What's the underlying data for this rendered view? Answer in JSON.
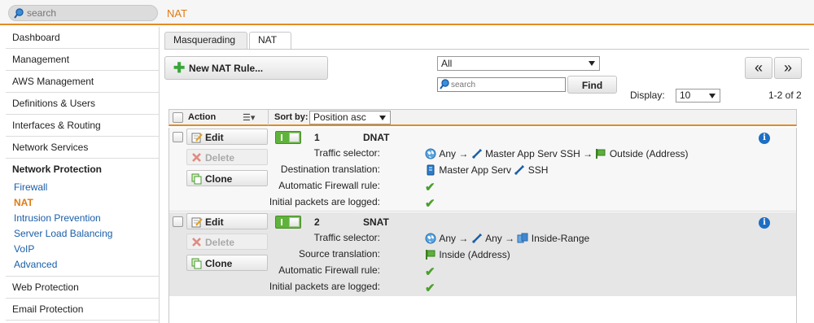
{
  "topbar": {
    "search_placeholder": "search",
    "page_title": "NAT"
  },
  "sidebar": {
    "items_top": [
      "Dashboard",
      "Management",
      "AWS Management",
      "Definitions & Users",
      "Interfaces & Routing",
      "Network Services"
    ],
    "group": {
      "title": "Network Protection",
      "subitems": [
        "Firewall",
        "NAT",
        "Intrusion Prevention",
        "Server Load Balancing",
        "VoIP",
        "Advanced"
      ],
      "active": "NAT"
    },
    "items_bottom": [
      "Web Protection",
      "Email Protection"
    ]
  },
  "tabs": [
    "Masquerading",
    "NAT"
  ],
  "active_tab": "NAT",
  "toolbar": {
    "new_rule_label": "New NAT Rule...",
    "filter_value": "All",
    "list_search_placeholder": "search",
    "find_label": "Find",
    "prev_label": "«",
    "next_label": "»",
    "display_label": "Display:",
    "display_value": "10",
    "count_text": "1-2 of 2"
  },
  "list_header": {
    "action_label": "Action",
    "sort_by_label": "Sort by:",
    "sort_value": "Position asc"
  },
  "rule_buttons": {
    "edit": "Edit",
    "delete": "Delete",
    "clone": "Clone"
  },
  "rules": [
    {
      "number": "1",
      "type": "DNAT",
      "enabled": true,
      "props": {
        "traffic_selector_label": "Traffic selector:",
        "traffic_selector": {
          "source": "Any",
          "service": "Master App Serv SSH",
          "destination": "Outside (Address)"
        },
        "translation_label": "Destination translation:",
        "translation": {
          "host": "Master App Serv",
          "service": "SSH"
        },
        "auto_fw_label": "Automatic Firewall rule:",
        "logged_label": "Initial packets are logged:"
      }
    },
    {
      "number": "2",
      "type": "SNAT",
      "enabled": true,
      "props": {
        "traffic_selector_label": "Traffic selector:",
        "traffic_selector": {
          "source": "Any",
          "service": "Any",
          "destination": "Inside-Range"
        },
        "translation_label": "Source translation:",
        "translation": {
          "host": "Inside (Address)"
        },
        "auto_fw_label": "Automatic Firewall rule:",
        "logged_label": "Initial packets are logged:"
      }
    }
  ],
  "symbols": {
    "arrow": "→",
    "check": "✔",
    "info": "i",
    "plus": "✚"
  },
  "icons": [
    "search-icon",
    "plus-icon",
    "edit-icon",
    "delete-icon",
    "clone-icon",
    "globe-icon",
    "service-icon",
    "host-icon",
    "network-icon",
    "flag-icon",
    "check-icon",
    "info-icon",
    "list-settings-icon"
  ],
  "colors": {
    "accent": "#e38b24",
    "link": "#1a5ea8",
    "toggle_on": "#5fb33a",
    "check": "#4aa02c",
    "info": "#1c6fc4"
  }
}
